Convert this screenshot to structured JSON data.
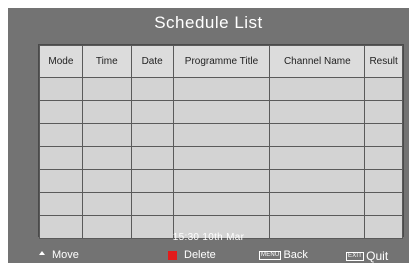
{
  "title": "Schedule List",
  "table": {
    "headers": [
      "Mode",
      "Time",
      "Date",
      "Programme Title",
      "Channel Name",
      "Result"
    ],
    "rows": [
      [
        "",
        "",
        "",
        "",
        "",
        ""
      ],
      [
        "",
        "",
        "",
        "",
        "",
        ""
      ],
      [
        "",
        "",
        "",
        "",
        "",
        ""
      ],
      [
        "",
        "",
        "",
        "",
        "",
        ""
      ],
      [
        "",
        "",
        "",
        "",
        "",
        ""
      ],
      [
        "",
        "",
        "",
        "",
        "",
        ""
      ],
      [
        "",
        "",
        "",
        "",
        "",
        ""
      ]
    ]
  },
  "clock": "15:30  10th Mar",
  "footer": {
    "move_label": "Move",
    "move_icon": "up-arrow-icon",
    "delete_label": "Delete",
    "delete_color": "#e21b1b",
    "back_key": "MENU",
    "back_label": "Back",
    "quit_key": "EXIT",
    "quit_label": "Quit"
  }
}
